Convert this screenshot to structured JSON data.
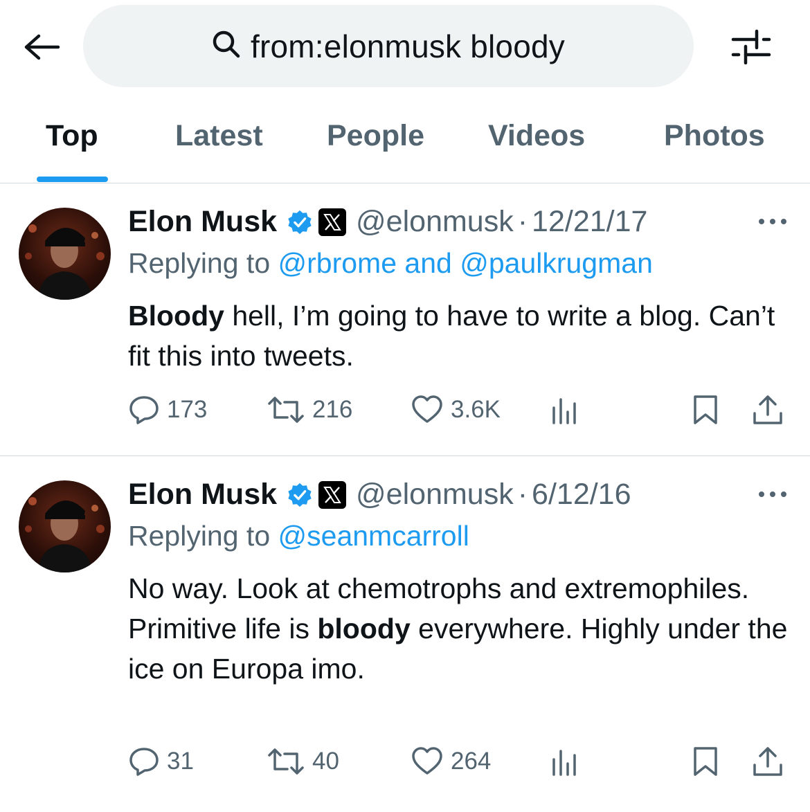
{
  "search": {
    "query": "from:elonmusk bloody"
  },
  "tabs": [
    {
      "label": "Top",
      "active": true
    },
    {
      "label": "Latest"
    },
    {
      "label": "People"
    },
    {
      "label": "Videos"
    },
    {
      "label": "Photos"
    }
  ],
  "colors": {
    "accent": "#1d9bf0",
    "text": "#0f1419",
    "muted": "#536471",
    "search_bg": "#eff3f4"
  },
  "tweets": [
    {
      "name": "Elon Musk",
      "handle": "@elonmusk",
      "separator": "·",
      "date": "12/21/17",
      "replying_prefix": "Replying to ",
      "reply_to_1": "@rbrome",
      "reply_joiner": " and ",
      "reply_to_2": "@paulkrugman",
      "text_bold": "Bloody",
      "text_rest": " hell, I’m going to have to write a blog. Can’t fit this into tweets.",
      "replies": "173",
      "reposts": "216",
      "likes": "3.6K"
    },
    {
      "name": "Elon Musk",
      "handle": "@elonmusk",
      "separator": "·",
      "date": "6/12/16",
      "replying_prefix": "Replying to ",
      "reply_to_1": "@seanmcarroll",
      "text_pre": "No way. Look at chemotrophs and extremophiles. Primitive life is ",
      "text_bold": "bloody",
      "text_post": " everywhere. Highly under the ice on Europa imo.",
      "replies": "31",
      "reposts": "40",
      "likes": "264"
    }
  ]
}
